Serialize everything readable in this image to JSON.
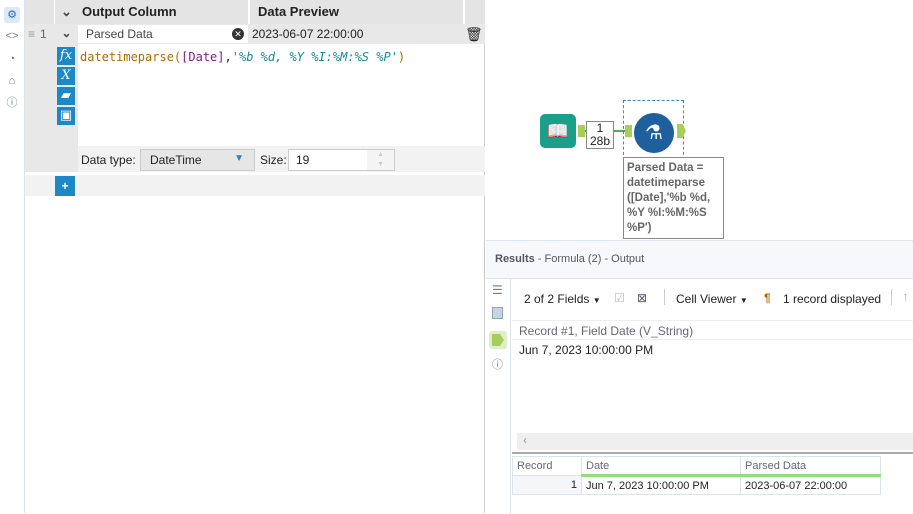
{
  "rail": {
    "icons": [
      "gear-icon",
      "code-icon",
      "arrow-circle-icon",
      "tag-icon",
      "help-icon"
    ]
  },
  "formula": {
    "headers": {
      "output_column": "Output Column",
      "data_preview": "Data Preview"
    },
    "rows": [
      {
        "number": "1",
        "output_column": "Parsed Data",
        "preview": "2023-06-07 22:00:00",
        "expr": {
          "func": "datetimeparse",
          "open": "(",
          "field": "[Date]",
          "comma": ",",
          "str": "'%b %d, %Y %I:%M:%S %P'",
          "close": ")"
        },
        "data_type_label": "Data type:",
        "data_type": "DateTime",
        "size_label": "Size:",
        "size": "19"
      }
    ],
    "side_icons": {
      "fx": "fx",
      "var": "X"
    },
    "add_label": "+"
  },
  "canvas": {
    "connection": {
      "records": "1",
      "size": "28b"
    },
    "annotation": "Parsed Data = datetimeparse ([Date],'%b %d, %Y %I:%M:%S %P')"
  },
  "results": {
    "title": "Results",
    "subtitle": " - Formula (2) - Output",
    "fields": "2 of 2 Fields",
    "viewer": "Cell Viewer",
    "records_displayed": "1 record displayed",
    "cell_header": "Record #1, Field Date (V_String)",
    "cell_value": "Jun 7, 2023 10:00:00 PM",
    "columns": [
      "Record",
      "Date",
      "Parsed Data"
    ],
    "rows": [
      [
        "1",
        "Jun 7, 2023 10:00:00 PM",
        "2023-06-07 22:00:00"
      ]
    ],
    "accent": "#8fe07a"
  }
}
